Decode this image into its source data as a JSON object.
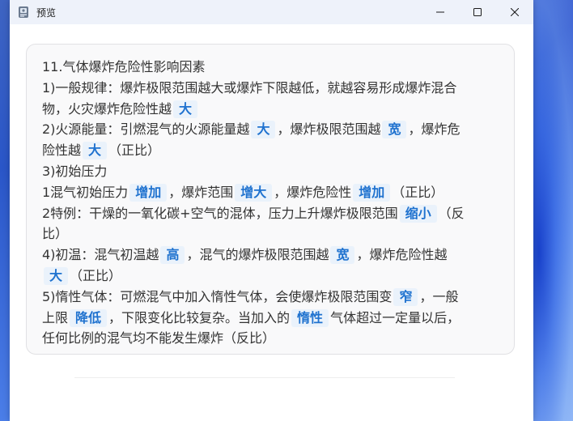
{
  "window": {
    "title": "预览",
    "app_icon": "preview-app-icon"
  },
  "controls": {
    "minimize_icon": "minimize-icon",
    "maximize_icon": "maximize-icon",
    "close_icon": "close-icon"
  },
  "content": {
    "heading": "11.气体爆炸危险性影响因素",
    "l1_a": "1)一般规律：爆炸极限范围越大或爆炸下限越低，就越容易形成爆炸混合",
    "l2_a": "物，火灾爆炸危险性越",
    "l2_hl1": "大",
    "l3_a": "2)火源能量：引燃混气的火源能量越",
    "l3_hl1": "大",
    "l3_b": "，爆炸极限范围越",
    "l3_hl2": "宽",
    "l3_c": "，爆炸危",
    "l4_a": "险性越",
    "l4_hl1": "大",
    "l4_b": "（正比）",
    "l5_a": "3)初始压力",
    "l6_a": "1混气初始压力",
    "l6_hl1": "增加",
    "l6_b": "，爆炸范围",
    "l6_hl2": "增大",
    "l6_c": "，爆炸危险性",
    "l6_hl3": "增加",
    "l6_d": "（正比）",
    "l7_a": "2特例：干燥的一氧化碳+空气的混体，压力上升爆炸极限范围",
    "l7_hl1": "缩小",
    "l7_b": "（反",
    "l8_a": "比）",
    "l9_a": "4)初温：混气初温越",
    "l9_hl1": "高",
    "l9_b": "，混气的爆炸极限范围越",
    "l9_hl2": "宽",
    "l9_c": "，爆炸危险性越",
    "l10_hl1": "大",
    "l10_a": "（正比）",
    "l11_a": "5)惰性气体：可燃混气中加入惰性气体，会使爆炸极限范围变",
    "l11_hl1": "窄",
    "l11_b": "，一般",
    "l12_a": "上限",
    "l12_hl1": "降低",
    "l12_b": "，下限变化比较复杂。当加入的",
    "l12_hl2": "惰性",
    "l12_c": "气体超过一定量以后，",
    "l13_a": "任何比例的混气均不能发生爆炸（反比）"
  }
}
